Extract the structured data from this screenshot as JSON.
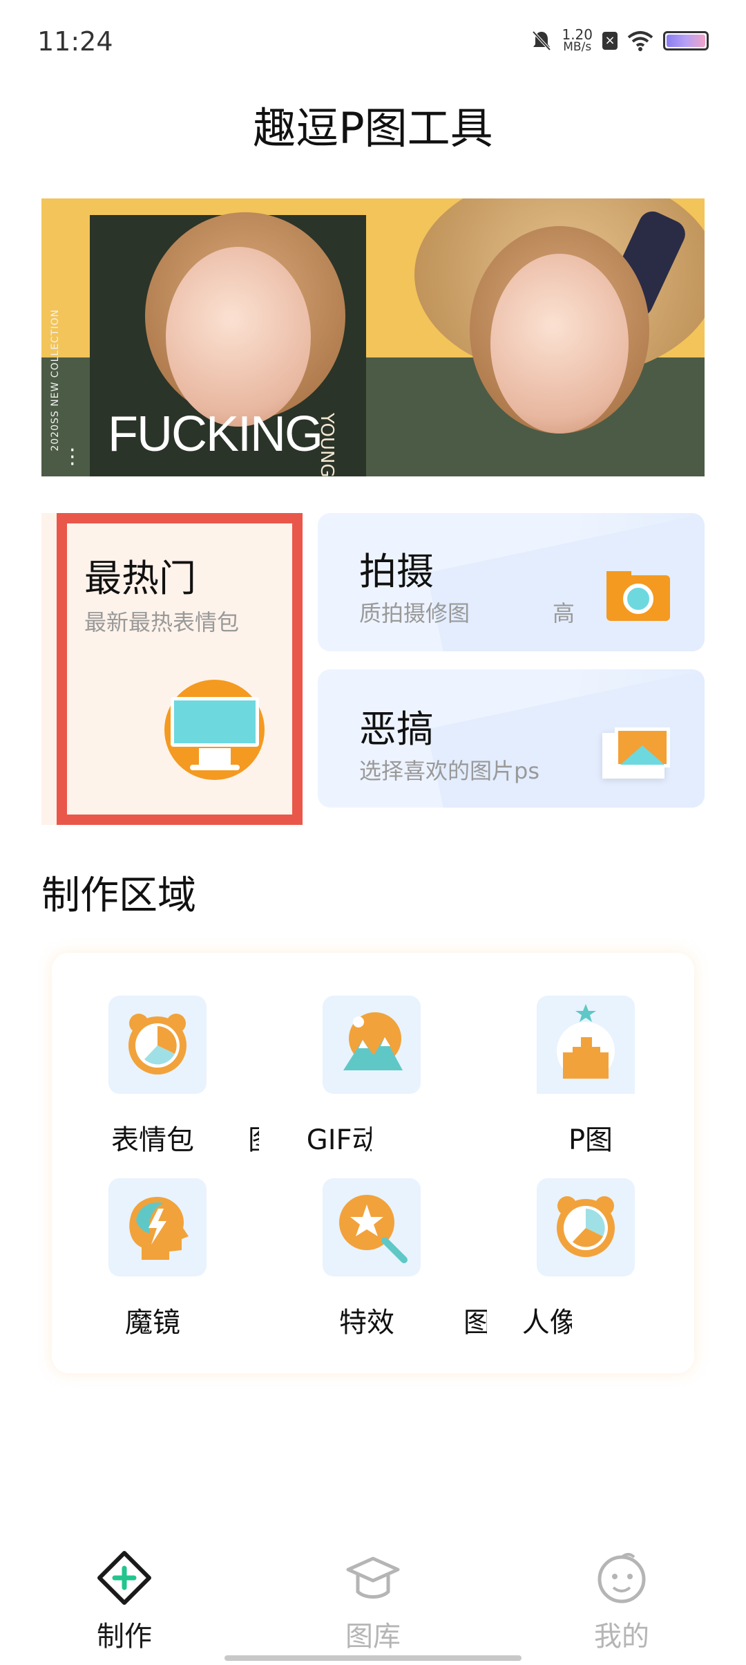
{
  "status_bar": {
    "time": "11:24",
    "net_speed_value": "1.20",
    "net_speed_unit": "MB/s"
  },
  "header": {
    "title": "趣逗P图工具"
  },
  "banner": {
    "headline": "FUCKING",
    "vertical_text": "2020SS NEW COLLECTION",
    "young_text": "YOUNG"
  },
  "cards": {
    "hot": {
      "title": "最热门",
      "subtitle": "最新最热表情包"
    },
    "shoot": {
      "title": "拍摄",
      "subtitle": "质拍摄修图",
      "subtitle_extra": "高"
    },
    "funny": {
      "title": "恶搞",
      "subtitle": "选择喜欢的图片ps"
    }
  },
  "section": {
    "title": "制作区域"
  },
  "tools": [
    {
      "label": "表情包",
      "icon": "clock-face-icon"
    },
    {
      "label": "GIF动",
      "prefix": "图",
      "icon": "mountain-sun-icon"
    },
    {
      "label": "P图",
      "icon": "castle-icon"
    },
    {
      "label": "魔镜",
      "icon": "head-bolt-icon"
    },
    {
      "label": "特效",
      "icon": "magic-wand-icon"
    },
    {
      "label": "人像",
      "prefix": "图",
      "icon": "alarm-clock-icon"
    }
  ],
  "nav": {
    "make": "制作",
    "gallery": "图库",
    "mine": "我的",
    "active": "make",
    "active_color": "#1a1a1a",
    "accent_color": "#23c48e",
    "inactive_color": "#b5b5b5"
  }
}
